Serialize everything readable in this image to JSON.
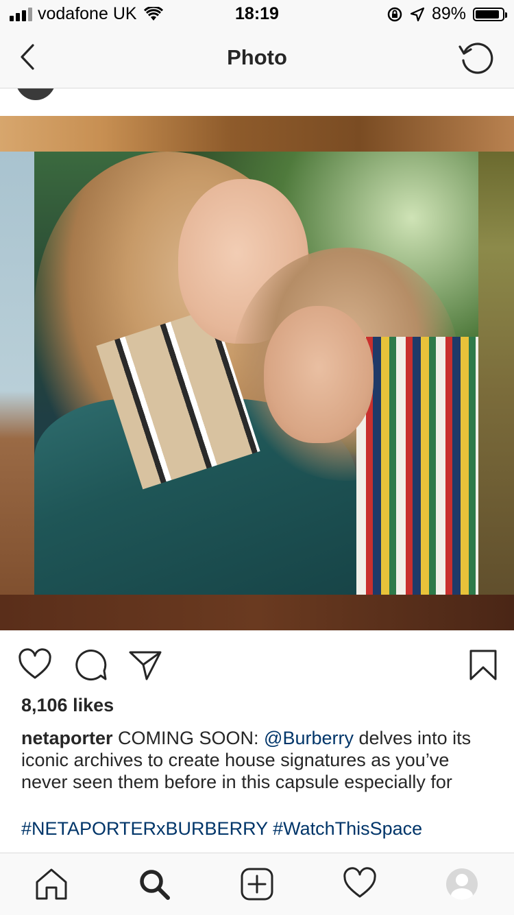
{
  "status_bar": {
    "carrier": "vodafone UK",
    "time": "18:19",
    "battery_percent": "89%",
    "battery_level": 0.89,
    "icons": [
      "signal-icon",
      "wifi-icon",
      "rotation-lock-icon",
      "location-arrow-icon",
      "battery-icon"
    ]
  },
  "nav": {
    "title": "Photo",
    "back_icon": "chevron-left-icon",
    "refresh_icon": "refresh-icon"
  },
  "post": {
    "likes": "8,106 likes",
    "username": "netaporter",
    "caption_part1": " COMING SOON: ",
    "mention": "@Burberry",
    "caption_part2": " delves into its iconic archives to create house signatures as you’ve never seen them before in this capsule especially for",
    "hashtags": "#NETAPORTERxBURBERRY #WatchThisSpace",
    "action_icons": [
      "heart-icon",
      "comment-icon",
      "share-icon",
      "bookmark-icon"
    ]
  },
  "tab_bar": {
    "items": [
      "home-icon",
      "search-icon",
      "add-post-icon",
      "activity-heart-icon",
      "profile-avatar"
    ]
  },
  "colors": {
    "link": "#003569",
    "text": "#262626",
    "bar_bg": "#f8f8f8",
    "border": "#dbdbdb"
  }
}
